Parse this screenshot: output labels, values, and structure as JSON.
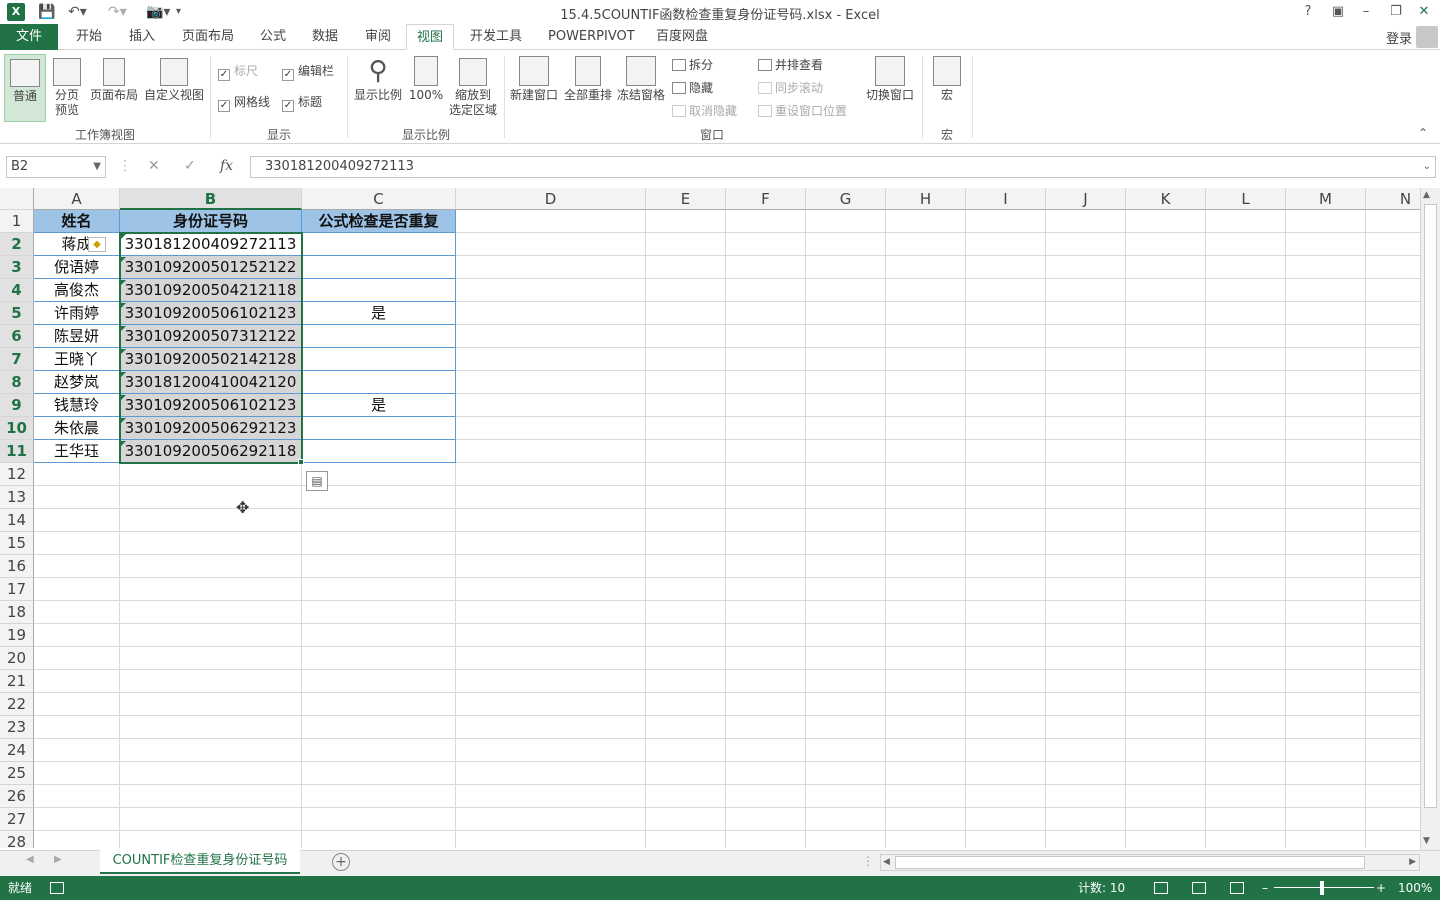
{
  "window": {
    "title": "15.4.5COUNTIF函数检查重复身份证号码.xlsx - Excel",
    "help": "?",
    "login": "登录"
  },
  "tabs": [
    "文件",
    "开始",
    "插入",
    "页面布局",
    "公式",
    "数据",
    "审阅",
    "视图",
    "开发工具",
    "POWERPIVOT",
    "百度网盘"
  ],
  "active_tab": "视图",
  "ribbon": {
    "workbook_views": {
      "label": "工作簿视图",
      "normal": "普通",
      "page_break_1": "分页",
      "page_break_2": "预览",
      "page_layout": "页面布局",
      "custom": "自定义视图"
    },
    "show": {
      "label": "显示",
      "ruler": "标尺",
      "formula_bar": "编辑栏",
      "gridlines": "网格线",
      "headings": "标题"
    },
    "zoom": {
      "label": "显示比例",
      "zoom": "显示比例",
      "hundred": "100%",
      "zoom_sel_1": "缩放到",
      "zoom_sel_2": "选定区域"
    },
    "window": {
      "label": "窗口",
      "new_window": "新建窗口",
      "arrange_all": "全部重排",
      "freeze": "冻结窗格",
      "split": "拆分",
      "hide": "隐藏",
      "unhide": "取消隐藏",
      "side_by_side": "并排查看",
      "sync_scroll": "同步滚动",
      "reset_pos": "重设窗口位置",
      "switch": "切换窗口"
    },
    "macros": {
      "label": "宏",
      "macro": "宏"
    }
  },
  "formula_bar": {
    "name_box": "B2",
    "fx": "fx",
    "content": "330181200409272113"
  },
  "columns": [
    "A",
    "B",
    "C",
    "D",
    "E",
    "F",
    "G",
    "H",
    "I",
    "J",
    "K",
    "L",
    "M",
    "N"
  ],
  "rows": [
    "1",
    "2",
    "3",
    "4",
    "5",
    "6",
    "7",
    "8",
    "9",
    "10",
    "11",
    "12",
    "13",
    "14",
    "15",
    "16",
    "17",
    "18",
    "19",
    "20",
    "21",
    "22",
    "23",
    "24",
    "25",
    "26",
    "27",
    "28"
  ],
  "table": {
    "headers": [
      "姓名",
      "身份证号码",
      "公式检查是否重复"
    ],
    "rows": [
      [
        "蒋成",
        "330181200409272113",
        ""
      ],
      [
        "倪语婷",
        "330109200501252122",
        ""
      ],
      [
        "高俊杰",
        "330109200504212118",
        ""
      ],
      [
        "许雨婷",
        "330109200506102123",
        "是"
      ],
      [
        "陈昱妍",
        "330109200507312122",
        ""
      ],
      [
        "王晓丫",
        "330109200502142128",
        ""
      ],
      [
        "赵梦岚",
        "330181200410042120",
        ""
      ],
      [
        "钱慧玲",
        "330109200506102123",
        "是"
      ],
      [
        "朱依晨",
        "330109200506292123",
        ""
      ],
      [
        "王华珏",
        "330109200506292118",
        ""
      ]
    ]
  },
  "sheet_tab": "COUNTIF检查重复身份证号码",
  "status": {
    "ready": "就绪",
    "count": "计数: 10",
    "zoom": "100%"
  },
  "colors": {
    "accent": "#217346",
    "header_fill": "#9dc3e6",
    "table_border": "#5b9bd5"
  }
}
